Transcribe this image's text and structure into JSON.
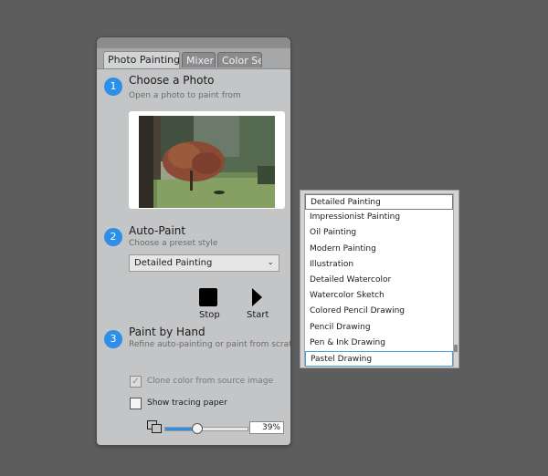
{
  "tabs": [
    "Photo Painting",
    "Mixer",
    "Color Se"
  ],
  "steps": [
    {
      "number": "1",
      "title": "Choose a Photo",
      "subtitle": "Open a photo to paint from"
    },
    {
      "number": "2",
      "title": "Auto-Paint",
      "subtitle": "Choose a preset style"
    },
    {
      "number": "3",
      "title": "Paint by Hand",
      "subtitle": "Refine auto-painting or paint from scratch"
    }
  ],
  "preset_select": {
    "value": "Detailed Painting"
  },
  "buttons": {
    "stop": "Stop",
    "start": "Start"
  },
  "options": {
    "clone_color": {
      "label": "Clone color from source image",
      "checked": true,
      "enabled": false
    },
    "tracing_paper": {
      "label": "Show tracing paper",
      "checked": false
    }
  },
  "zoom": {
    "value": "39%",
    "level": 0.39
  },
  "dropdown": {
    "items": [
      "Detailed Painting",
      "Impressionist Painting",
      "Oil Painting",
      "Modern Painting",
      "Illustration",
      "Detailed Watercolor",
      "Watercolor Sketch",
      "Colored Pencil Drawing",
      "Pencil Drawing",
      "Pen & Ink Drawing",
      "Pastel Drawing"
    ],
    "selected_index": 0,
    "hover_index": 10
  },
  "colors": {
    "accent": "#2d8fe8",
    "panel": "#c4c5c7",
    "background": "#5d5d5d"
  }
}
